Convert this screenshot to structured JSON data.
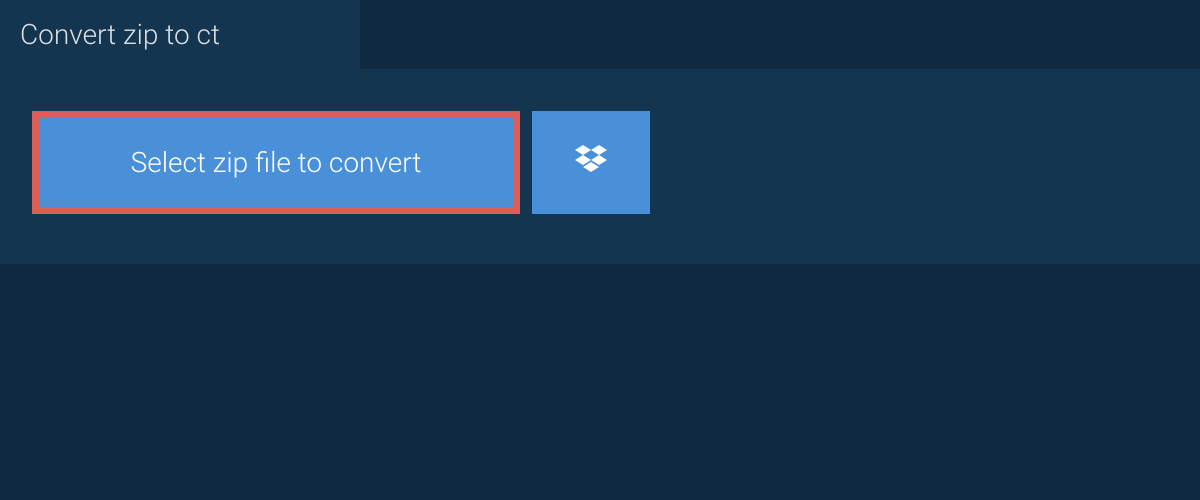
{
  "tab": {
    "title": "Convert zip to ct"
  },
  "buttons": {
    "select_label": "Select zip file to convert"
  }
}
